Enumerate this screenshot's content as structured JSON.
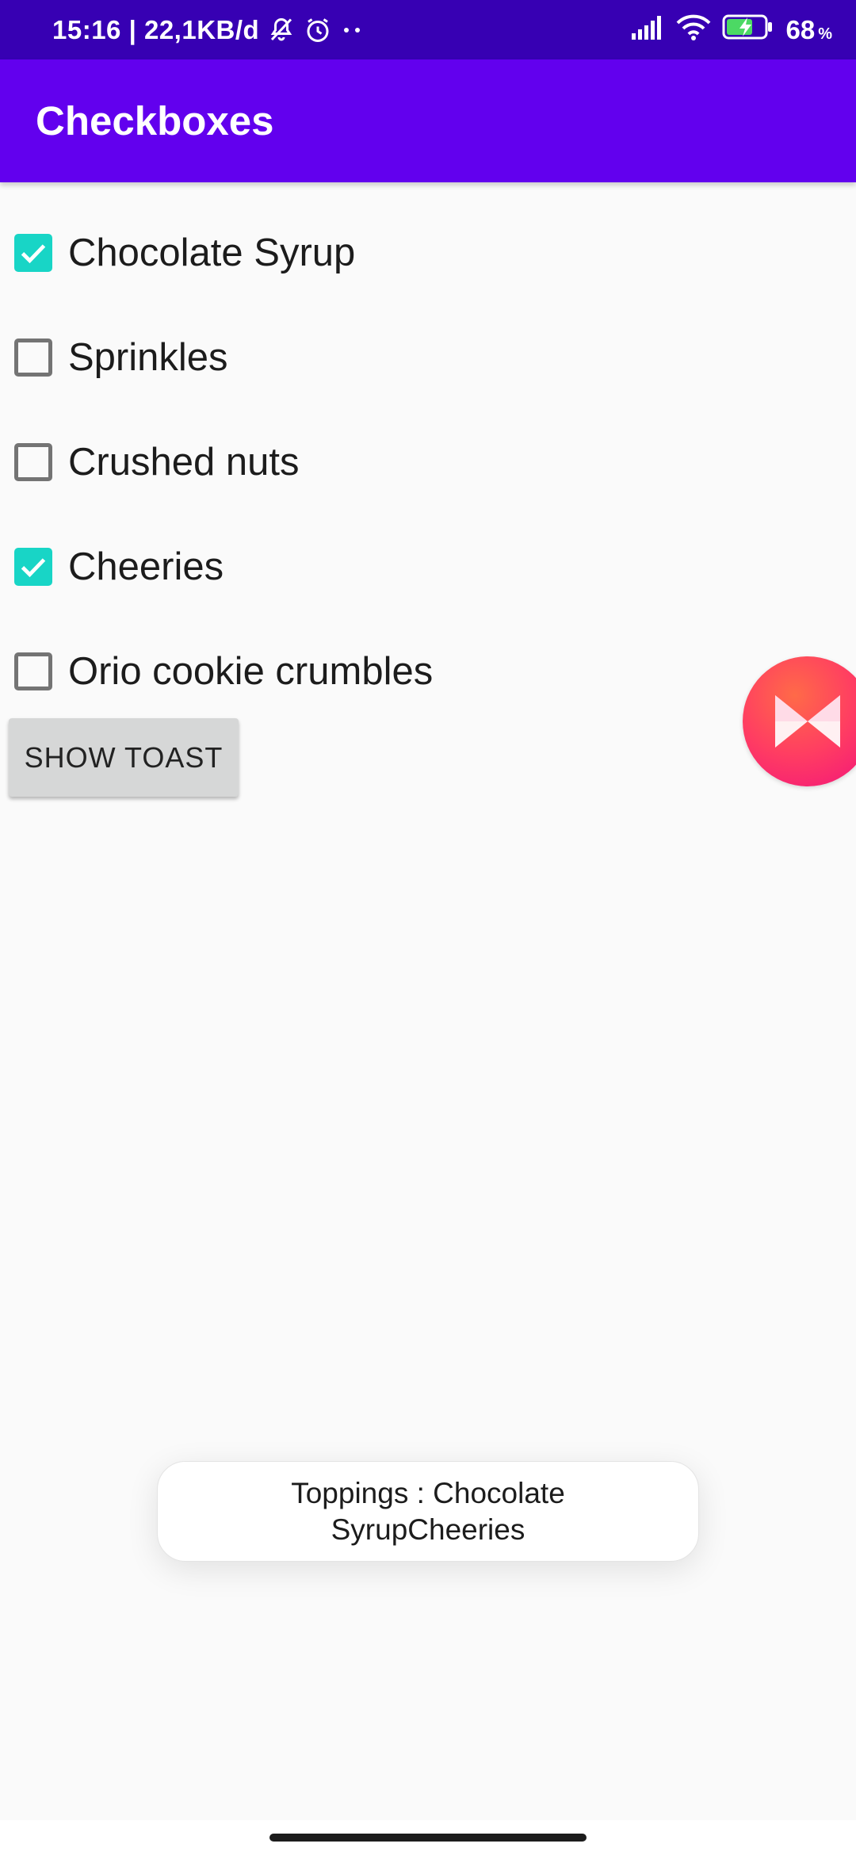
{
  "status_bar": {
    "time_and_speed": "15:16 | 22,1KB/d",
    "battery_percent": "68",
    "battery_unit": "%"
  },
  "app_bar": {
    "title": "Checkboxes"
  },
  "checkboxes": [
    {
      "label": "Chocolate Syrup",
      "checked": true
    },
    {
      "label": "Sprinkles",
      "checked": false
    },
    {
      "label": "Crushed nuts",
      "checked": false
    },
    {
      "label": "Cheeries",
      "checked": true
    },
    {
      "label": "Orio cookie crumbles",
      "checked": false
    }
  ],
  "button": {
    "label": "SHOW TOAST"
  },
  "toast": {
    "text": "Toppings : Chocolate SyrupCheeries"
  },
  "colors": {
    "status_bar": "#3700b3",
    "app_bar": "#6200ee",
    "checkbox_accent": "#18d5c6"
  },
  "icons": [
    "bell-off-icon",
    "alarm-icon",
    "more-dots-icon",
    "signal-icon",
    "wifi-icon",
    "battery-charging-icon",
    "floating-bubble-icon"
  ]
}
